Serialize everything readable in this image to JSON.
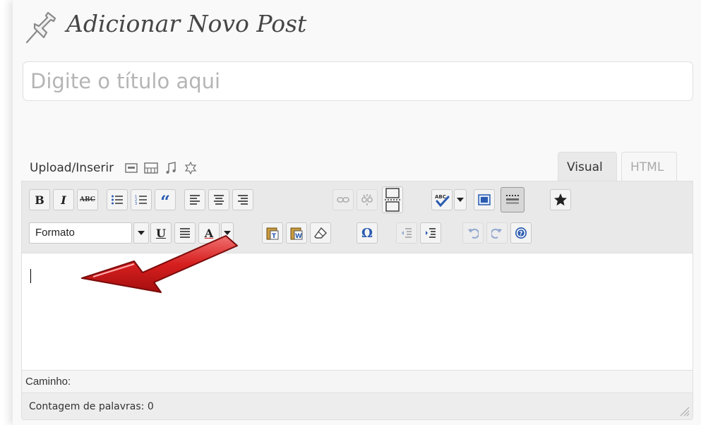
{
  "header": {
    "title": "Adicionar Novo Post",
    "icon": "pushpin-icon"
  },
  "title_field": {
    "placeholder": "Digite o título aqui",
    "value": ""
  },
  "media": {
    "label": "Upload/Inserir",
    "icons": [
      "image-icon",
      "video-icon",
      "audio-icon",
      "media-icon"
    ]
  },
  "tabs": [
    {
      "label": "Visual",
      "active": true
    },
    {
      "label": "HTML",
      "active": false
    }
  ],
  "toolbar": {
    "row1": [
      "bold",
      "italic",
      "strikethrough",
      "bullet-list",
      "numbered-list",
      "blockquote",
      "align-left",
      "align-center",
      "align-right",
      "insert-link",
      "unlink",
      "insert-more",
      "spellcheck",
      "fullscreen",
      "kitchen-sink",
      "star"
    ],
    "format_select": "Formato",
    "row2": [
      "underline",
      "justify",
      "text-color",
      "paste-text",
      "paste-word",
      "remove-format",
      "special-character",
      "outdent",
      "indent",
      "undo",
      "redo",
      "help"
    ],
    "labels": {
      "bold": "B",
      "italic": "I",
      "strike": "ABC",
      "quote": "“",
      "underline": "U",
      "omega": "Ω",
      "text_color": "A"
    }
  },
  "editor": {
    "content": ""
  },
  "path_bar": {
    "label": "Caminho:"
  },
  "status": {
    "word_count": "Contagem de palavras: 0"
  },
  "colors": {
    "accent": "#21759b",
    "arrow": "#d71f1f",
    "background": "#f9f9f9"
  }
}
